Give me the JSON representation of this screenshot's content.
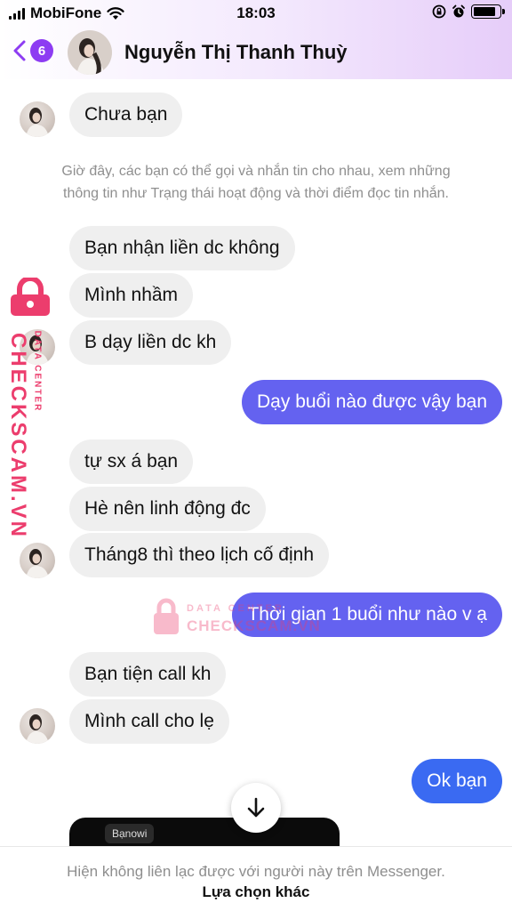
{
  "status_bar": {
    "carrier": "MobiFone",
    "time": "18:03"
  },
  "header": {
    "back_count": "6",
    "contact_name": "Nguyễn Thị Thanh Thuỳ"
  },
  "notice": {
    "line1": "Giờ đây, các bạn có thể gọi và nhắn tin cho nhau, xem những",
    "line2": "thông tin như Trạng thái hoạt động và thời điểm đọc tin nhắn."
  },
  "messages": [
    {
      "direction": "incoming",
      "text": "Chưa bạn"
    },
    {
      "direction": "incoming",
      "text": "Bạn nhận liền dc không"
    },
    {
      "direction": "incoming",
      "text": "Mình nhầm"
    },
    {
      "direction": "incoming",
      "text": "B dạy liền dc kh"
    },
    {
      "direction": "outgoing",
      "text": "Dạy buổi nào được vậy bạn"
    },
    {
      "direction": "incoming",
      "text": "tự sx á bạn"
    },
    {
      "direction": "incoming",
      "text": "Hè nên linh động đc"
    },
    {
      "direction": "incoming",
      "text": "Tháng8 thì theo lịch cố định"
    },
    {
      "direction": "outgoing",
      "text": "Thời gian 1 buổi như nào v ạ"
    },
    {
      "direction": "incoming",
      "text": "Bạn tiện call kh"
    },
    {
      "direction": "incoming",
      "text": "Mình call cho lẹ"
    },
    {
      "direction": "outgoing",
      "text": "Ok bạn"
    }
  ],
  "media_preview": {
    "tag": "Bạnowi"
  },
  "footer": {
    "text": "Hiện không liên lạc được với người này trên Messenger.",
    "link": "Lựa chọn khác"
  },
  "watermark": {
    "brand": "CHECKSCAM.VN",
    "tagline": "DATA CENTER"
  },
  "colors": {
    "outgoing_bubble": "#6462f0",
    "outgoing_bubble_last": "#3a6af2",
    "incoming_bubble": "#efefef",
    "accent": "#8d3cf2",
    "watermark": "#ec3d6d"
  },
  "icons": [
    "back-chevron-icon",
    "wifi-icon",
    "lock-rotation-icon",
    "alarm-icon",
    "battery-icon",
    "scroll-down-arrow-icon",
    "lock-icon"
  ]
}
